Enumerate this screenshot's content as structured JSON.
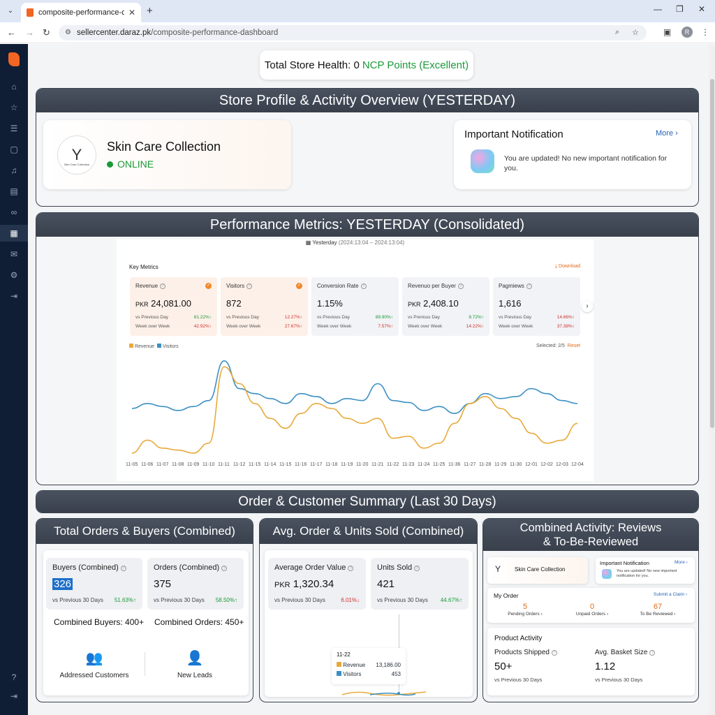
{
  "browser": {
    "tab_title": "composite-performance-dashb",
    "url_host": "sellercenter.daraz.pk",
    "url_path": "/composite-performance-dashboard",
    "profile_initial": "R"
  },
  "health": {
    "prefix": "Total Store Health: 0",
    "highlight": "NCP Points (Excellent)"
  },
  "profile_panel": {
    "title": "Store Profile & Activity Overview (YESTERDAY)",
    "store_name": "Skin Care Collection",
    "status": "ONLINE",
    "logo_caption": "Skin Care Collection",
    "notification": {
      "title": "Important Notification",
      "more": "More",
      "message": "You are updated! No new important notification for you."
    }
  },
  "performance_panel": {
    "title": "Performance Metrics: YESTERDAY (Consolidated)",
    "date_label": "Yesterday",
    "date_range": "(2024:13:04 – 2024:13:04)",
    "key_metrics": "Key Metrics",
    "download": "Download",
    "metrics": [
      {
        "name": "Revenue",
        "currency": "PKR",
        "value": "24,081.00",
        "r1_label": "vs Previous Day",
        "r1_val": "81.22%↑",
        "r1_dir": "up",
        "r2_label": "Week over Week",
        "r2_val": "42.92%↑",
        "r2_dir": "dn"
      },
      {
        "name": "Visitors",
        "currency": "",
        "value": "872",
        "r1_label": "vs Previous Day",
        "r1_val": "12.27%↑",
        "r1_dir": "dn",
        "r2_label": "Week over Week",
        "r2_val": "27.67%↑",
        "r2_dir": "dn"
      },
      {
        "name": "Conversion Rate",
        "currency": "",
        "value": "1.15%",
        "r1_label": "vs Previous Day",
        "r1_val": "89.90%↑",
        "r1_dir": "up",
        "r2_label": "Week over Week",
        "r2_val": "7.57%↑",
        "r2_dir": "dn"
      },
      {
        "name": "Revenuo per Buyer",
        "currency": "PKR",
        "value": "2,408.10",
        "r1_label": "vs Prerious Day",
        "r1_val": "8.72%↑",
        "r1_dir": "up",
        "r2_label": "Week over Week",
        "r2_val": "14.22%↑",
        "r2_dir": "dn"
      },
      {
        "name": "Pagmiews",
        "currency": "",
        "value": "1,616",
        "r1_label": "vs Previous Day",
        "r1_val": "14.66%↑",
        "r1_dir": "dn",
        "r2_label": "Week over Week",
        "r2_val": "37.38%↑",
        "r2_dir": "dn"
      }
    ],
    "legend": [
      "Revenue",
      "Visitors"
    ],
    "selected": "Selected: 2/5",
    "reset": "Reset",
    "colors": {
      "revenue": "#e8a93a",
      "visitors": "#3b8fc4"
    }
  },
  "chart_data": {
    "type": "line",
    "x": [
      "11-05",
      "11-06",
      "11-07",
      "11-08",
      "11-09",
      "11-10",
      "11-11",
      "11-12",
      "11-15",
      "11-14",
      "11-15",
      "11-16",
      "11-17",
      "11-18",
      "11-19",
      "11-20",
      "11-21",
      "11-22",
      "11-23",
      "11-24",
      "11-25",
      "11-36",
      "11-27",
      "11-28",
      "11-29",
      "11-30",
      "12-01",
      "12-02",
      "12-03",
      "12-04"
    ],
    "series": [
      {
        "name": "Revenue",
        "values": [
          5,
          18,
          10,
          8,
          5,
          15,
          92,
          75,
          55,
          40,
          30,
          45,
          55,
          50,
          40,
          35,
          40,
          20,
          22,
          10,
          15,
          35,
          55,
          62,
          50,
          40,
          25,
          15,
          18,
          35
        ]
      },
      {
        "name": "Visitors",
        "values": [
          50,
          55,
          52,
          48,
          52,
          58,
          98,
          70,
          65,
          60,
          55,
          65,
          62,
          55,
          60,
          58,
          75,
          58,
          56,
          48,
          52,
          45,
          55,
          65,
          60,
          62,
          70,
          65,
          58,
          55
        ]
      }
    ],
    "ylim": [
      0,
      100
    ],
    "grid": false,
    "legend": "top-left"
  },
  "orders_panel": {
    "title": "Order & Customer Summary (Last 30 Days)",
    "sub1": {
      "title": "Total Orders & Buyers (Combined)",
      "buyers_label": "Buyers (Combined)",
      "buyers_value": "326",
      "buyers_cmp": "vs Previous 30 Days",
      "buyers_pct": "51.63%↑",
      "orders_label": "Orders (Combined)",
      "orders_value": "375",
      "orders_cmp": "vs Previous 30 Days",
      "orders_pct": "58.50%↑",
      "combined_buyers": "Combined Buyers: 400+",
      "combined_orders": "Combined Orders: 450+",
      "addressed": "Addressed Customers",
      "new_leads": "New Leads"
    },
    "sub2": {
      "title": "Avg. Order & Units Sold (Combined)",
      "aov_label": "Average Order Value",
      "aov_currency": "PKR",
      "aov_value": "1,320.34",
      "aov_cmp": "vs Previous 30 Days",
      "aov_pct": "6.01%↓",
      "units_label": "Units Sold",
      "units_value": "421",
      "units_cmp": "vs Previous 30 Days",
      "units_pct": "44.67%↑",
      "tooltip_date": "11-22",
      "tooltip_rev_label": "Revenue",
      "tooltip_rev_value": "13,186.00",
      "tooltip_vis_label": "Visitors",
      "tooltip_vis_value": "453"
    },
    "sub3": {
      "title_line1": "Combined Activity: Reviews",
      "title_line2": "& To-Be-Reviewed",
      "store_name": "Skin Care Collection",
      "notif_title": "Important Notification",
      "notif_more": "More",
      "notif_msg": "You are updated! No new important notification for you.",
      "my_order": "My Order",
      "submit_claim": "Submit a Claim",
      "orders": [
        {
          "count": "5",
          "label": "Pending Orders"
        },
        {
          "count": "0",
          "label": "Unpaid Orders"
        },
        {
          "count": "67",
          "label": "To Be Reviewed"
        }
      ],
      "product_activity": "Product Activity",
      "shipped_label": "Products Shipped",
      "shipped_value": "50+",
      "shipped_cmp": "vs Previous 30 Days",
      "basket_label": "Avg. Basket Size",
      "basket_value": "1.12",
      "basket_cmp": "vs Previous 30 Days"
    }
  }
}
